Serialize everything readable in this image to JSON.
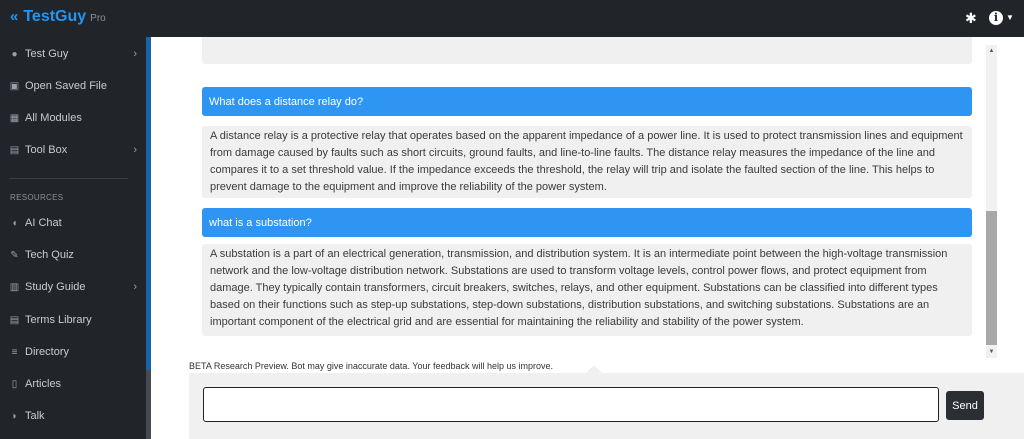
{
  "header": {
    "brand_chevron": "«",
    "brand_name": "TestGuy",
    "brand_sub": "Pro",
    "settings_icon": "gear-icon",
    "info_icon": "info-circle-icon"
  },
  "sidebar": {
    "items": [
      {
        "label": "Test Guy",
        "icon": "user-icon",
        "has_submenu": true
      },
      {
        "label": "Open Saved File",
        "icon": "save-icon",
        "has_submenu": false
      },
      {
        "label": "All Modules",
        "icon": "grid-icon",
        "has_submenu": false
      },
      {
        "label": "Tool Box",
        "icon": "toolbox-icon",
        "has_submenu": true
      }
    ],
    "resources_heading": "RESOURCES",
    "resource_items": [
      {
        "label": "AI Chat",
        "icon": "chat-icon",
        "has_submenu": false
      },
      {
        "label": "Tech Quiz",
        "icon": "pencil-icon",
        "has_submenu": false
      },
      {
        "label": "Study Guide",
        "icon": "book-icon",
        "has_submenu": true
      },
      {
        "label": "Terms Library",
        "icon": "list-icon",
        "has_submenu": false
      },
      {
        "label": "Directory",
        "icon": "directory-icon",
        "has_submenu": false
      },
      {
        "label": "Articles",
        "icon": "file-icon",
        "has_submenu": false
      },
      {
        "label": "Talk",
        "icon": "comments-icon",
        "has_submenu": false
      }
    ]
  },
  "chat": {
    "messages": [
      {
        "role": "user",
        "text": "What does a distance relay do?"
      },
      {
        "role": "bot",
        "text": "A distance relay is a protective relay that operates based on the apparent impedance of a power line. It is used to protect transmission lines and equipment from damage caused by faults such as short circuits, ground faults, and line-to-line faults. The distance relay measures the impedance of the line and compares it to a set threshold value. If the impedance exceeds the threshold, the relay will trip and isolate the faulted section of the line. This helps to prevent damage to the equipment and improve the reliability of the power system."
      },
      {
        "role": "user",
        "text": "what is a substation?"
      },
      {
        "role": "bot",
        "text": "A substation is a part of an electrical generation, transmission, and distribution system. It is an intermediate point between the high-voltage transmission network and the low-voltage distribution network. Substations are used to transform voltage levels, control power flows, and protect equipment from damage. They typically contain transformers, circuit breakers, switches, relays, and other equipment. Substations can be classified into different types based on their functions such as step-up substations, step-down substations, distribution substations, and switching substations. Substations are an important component of the electrical grid and are essential for maintaining the reliability and stability of the power system."
      }
    ],
    "beta_notice": "BETA Research Preview. Bot may give inaccurate data. Your feedback will help us improve.",
    "input_value": "",
    "send_label": "Send"
  },
  "colors": {
    "brand": "#2196f3",
    "question_bg": "#2e95f3",
    "answer_bg": "#f0f0f0",
    "sidebar_bg": "#212529"
  }
}
